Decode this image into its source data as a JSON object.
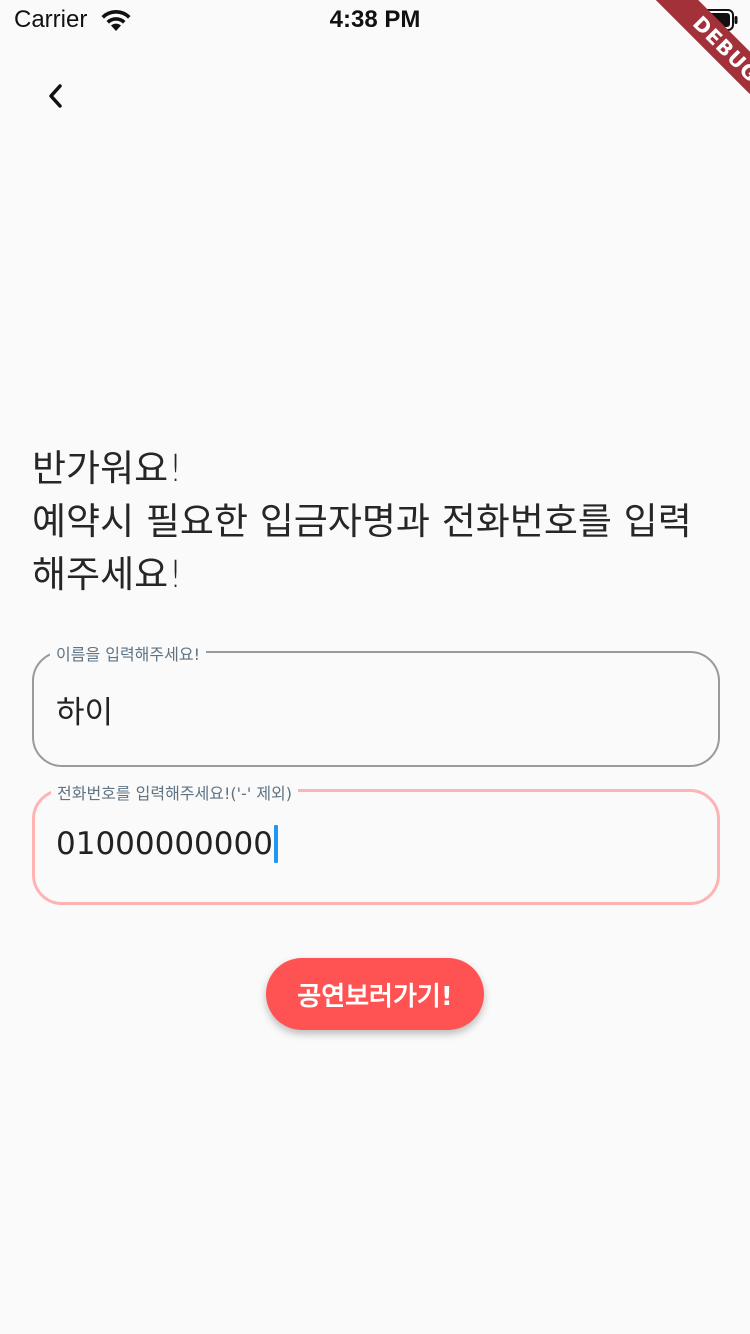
{
  "status_bar": {
    "carrier": "Carrier",
    "time": "4:38 PM"
  },
  "debug_banner": "DEBUG",
  "greeting": {
    "line1": "반가워요!",
    "line2": "예약시 필요한 입금자명과 전화번호를 입력",
    "line3": "해주세요!"
  },
  "name_field": {
    "label": "이름을 입력해주세요!",
    "value": "하이"
  },
  "phone_field": {
    "label": "전화번호를 입력해주세요!('-' 제외)",
    "value": "01000000000"
  },
  "submit_button": {
    "label": "공연보러가기!"
  },
  "colors": {
    "accent": "#ff5252",
    "focused_border": "#ffb3b3",
    "cursor": "#2196f3",
    "debug_ribbon": "#a3313a",
    "background": "#fafafa"
  },
  "icons": {
    "back": "chevron-left-icon",
    "wifi": "wifi-icon",
    "battery": "battery-icon"
  }
}
